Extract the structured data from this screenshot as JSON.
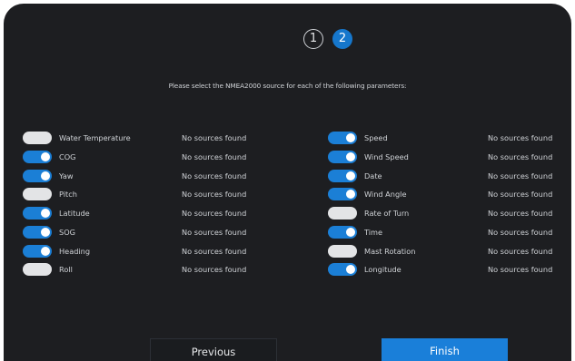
{
  "steps": [
    {
      "label": "1",
      "active": false
    },
    {
      "label": "2",
      "active": true
    }
  ],
  "instruction": "Please select the NMEA2000 source for each of the following parameters:",
  "left_params": [
    {
      "name": "Water Temperature",
      "enabled": false,
      "status": "No sources found"
    },
    {
      "name": "COG",
      "enabled": true,
      "status": "No sources found"
    },
    {
      "name": "Yaw",
      "enabled": true,
      "status": "No sources found"
    },
    {
      "name": "Pitch",
      "enabled": false,
      "status": "No sources found"
    },
    {
      "name": "Latitude",
      "enabled": true,
      "status": "No sources found"
    },
    {
      "name": "SOG",
      "enabled": true,
      "status": "No sources found"
    },
    {
      "name": "Heading",
      "enabled": true,
      "status": "No sources found"
    },
    {
      "name": "Roll",
      "enabled": false,
      "status": "No sources found"
    }
  ],
  "right_params": [
    {
      "name": "Speed",
      "enabled": true,
      "status": "No sources found"
    },
    {
      "name": "Wind Speed",
      "enabled": true,
      "status": "No sources found"
    },
    {
      "name": "Date",
      "enabled": true,
      "status": "No sources found"
    },
    {
      "name": "Wind Angle",
      "enabled": true,
      "status": "No sources found"
    },
    {
      "name": "Rate of Turn",
      "enabled": false,
      "status": "No sources found"
    },
    {
      "name": "Time",
      "enabled": true,
      "status": "No sources found"
    },
    {
      "name": "Mast Rotation",
      "enabled": false,
      "status": "No sources found"
    },
    {
      "name": "Longitude",
      "enabled": true,
      "status": "No sources found"
    }
  ],
  "buttons": {
    "previous": "Previous",
    "finish": "Finish"
  },
  "colors": {
    "background": "#1d1e21",
    "accent": "#1b7fd6",
    "toggle_off": "#e3e4e6",
    "text": "#cfd2d6"
  }
}
